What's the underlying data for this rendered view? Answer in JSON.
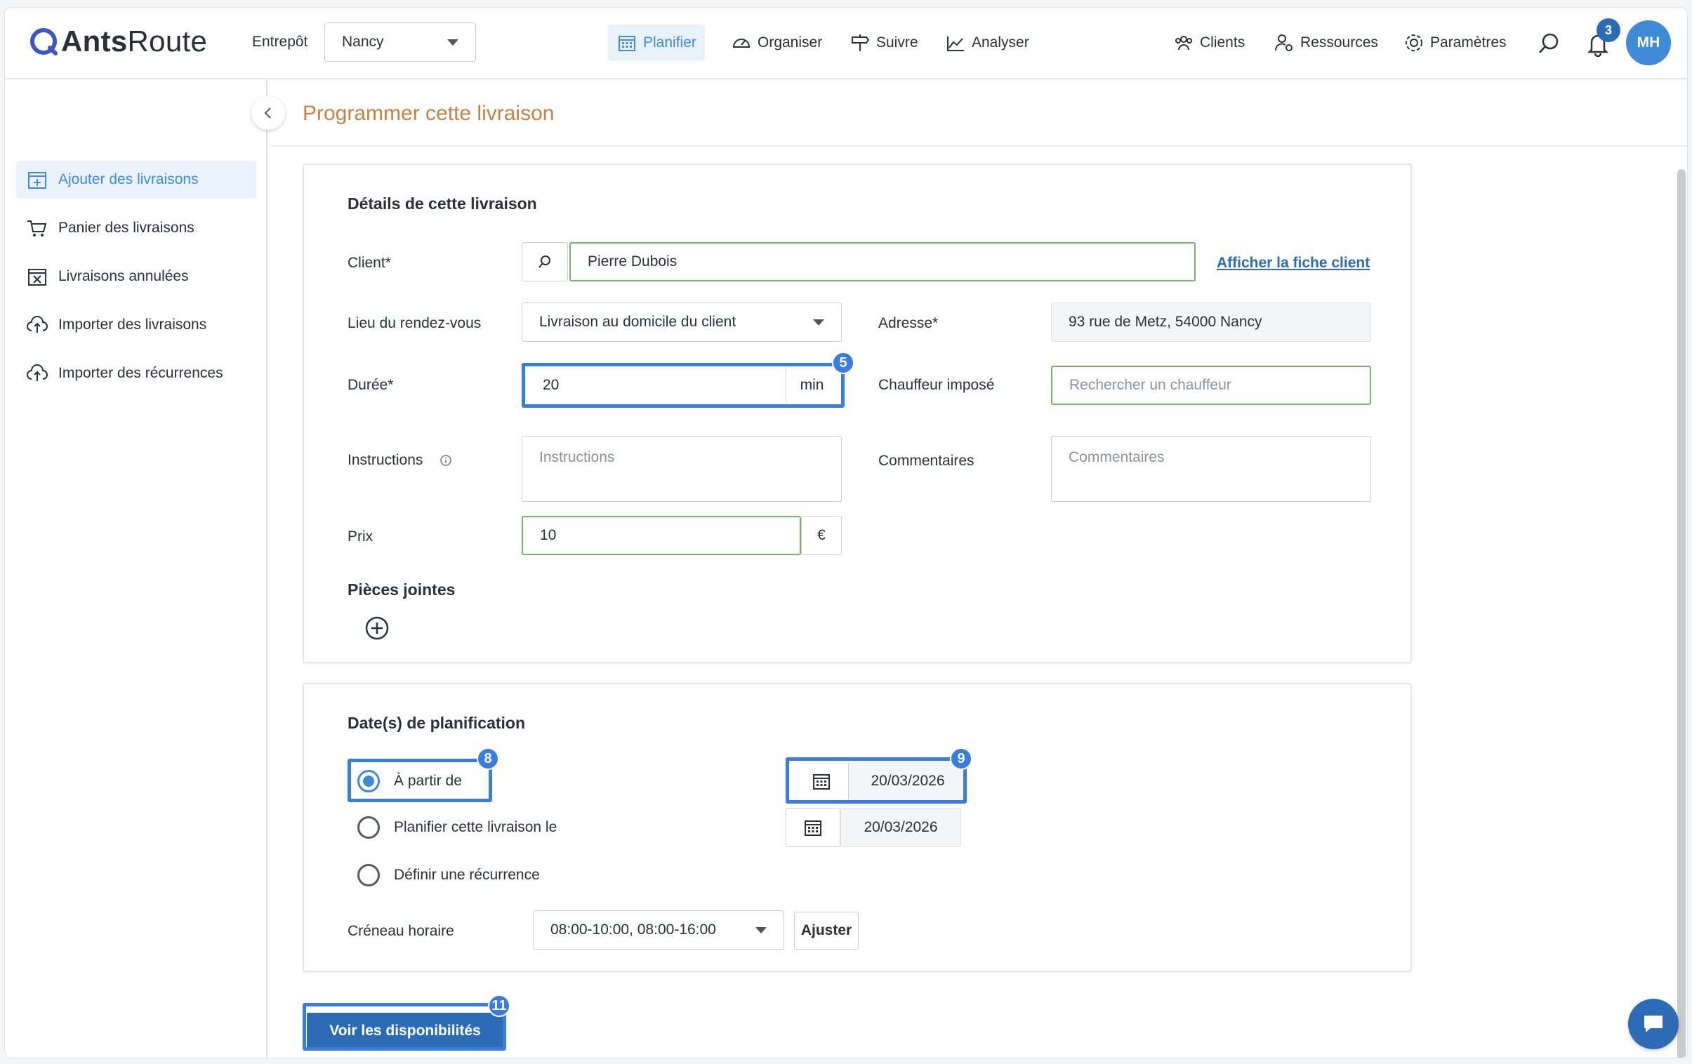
{
  "app": {
    "logo_bold": "Ants",
    "logo_light": "Route"
  },
  "header": {
    "entrepot_label": "Entrepôt",
    "entrepot_value": "Nancy",
    "nav": {
      "planifier": "Planifier",
      "organiser": "Organiser",
      "suivre": "Suivre",
      "analyser": "Analyser",
      "clients": "Clients",
      "ressources": "Ressources",
      "parametres": "Paramètres"
    },
    "notif_count": "3",
    "avatar_initials": "MH"
  },
  "sidebar": {
    "items": [
      {
        "label": "Ajouter des livraisons",
        "icon": "calendar-plus-icon",
        "active": true
      },
      {
        "label": "Panier des livraisons",
        "icon": "cart-icon",
        "active": false
      },
      {
        "label": "Livraisons annulées",
        "icon": "calendar-cancel-icon",
        "active": false
      },
      {
        "label": "Importer des livraisons",
        "icon": "cloud-upload-icon",
        "active": false
      },
      {
        "label": "Importer des récurrences",
        "icon": "cloud-upload-icon",
        "active": false
      }
    ]
  },
  "page": {
    "title": "Programmer cette livraison"
  },
  "details": {
    "title": "Détails de cette livraison",
    "client_label": "Client*",
    "client_value": "Pierre Dubois",
    "client_link": "Afficher la fiche client",
    "lieu_label": "Lieu du rendez-vous",
    "lieu_value": "Livraison au domicile du client",
    "adresse_label": "Adresse*",
    "adresse_value": "93 rue de Metz, 54000 Nancy",
    "duree_label": "Durée*",
    "duree_value": "20",
    "duree_unit": "min",
    "chauffeur_label": "Chauffeur imposé",
    "chauffeur_placeholder": "Rechercher un chauffeur",
    "instructions_label": "Instructions",
    "instructions_placeholder": "Instructions",
    "commentaires_label": "Commentaires",
    "commentaires_placeholder": "Commentaires",
    "prix_label": "Prix",
    "prix_value": "10",
    "prix_unit": "€",
    "pieces_title": "Pièces jointes"
  },
  "planning": {
    "title": "Date(s) de planification",
    "option_from": "À partir de",
    "option_on": "Planifier cette livraison le",
    "option_recurrence": "Définir une récurrence",
    "date_from": "20/03/2026",
    "date_on": "20/03/2026",
    "creneau_label": "Créneau horaire",
    "creneau_value": "08:00-10:00, 08:00-16:00",
    "ajuster": "Ajuster"
  },
  "actions": {
    "voir_dispo": "Voir les disponibilités"
  },
  "steps": {
    "duree": "5",
    "from_option": "8",
    "from_date": "9",
    "voir": "11"
  },
  "colors": {
    "accent": "#3d8bd9",
    "brand_dark": "#2c6cb7",
    "title_orange": "#c98143",
    "highlight": "#3a7de0",
    "valid_green": "#7cb36a"
  }
}
